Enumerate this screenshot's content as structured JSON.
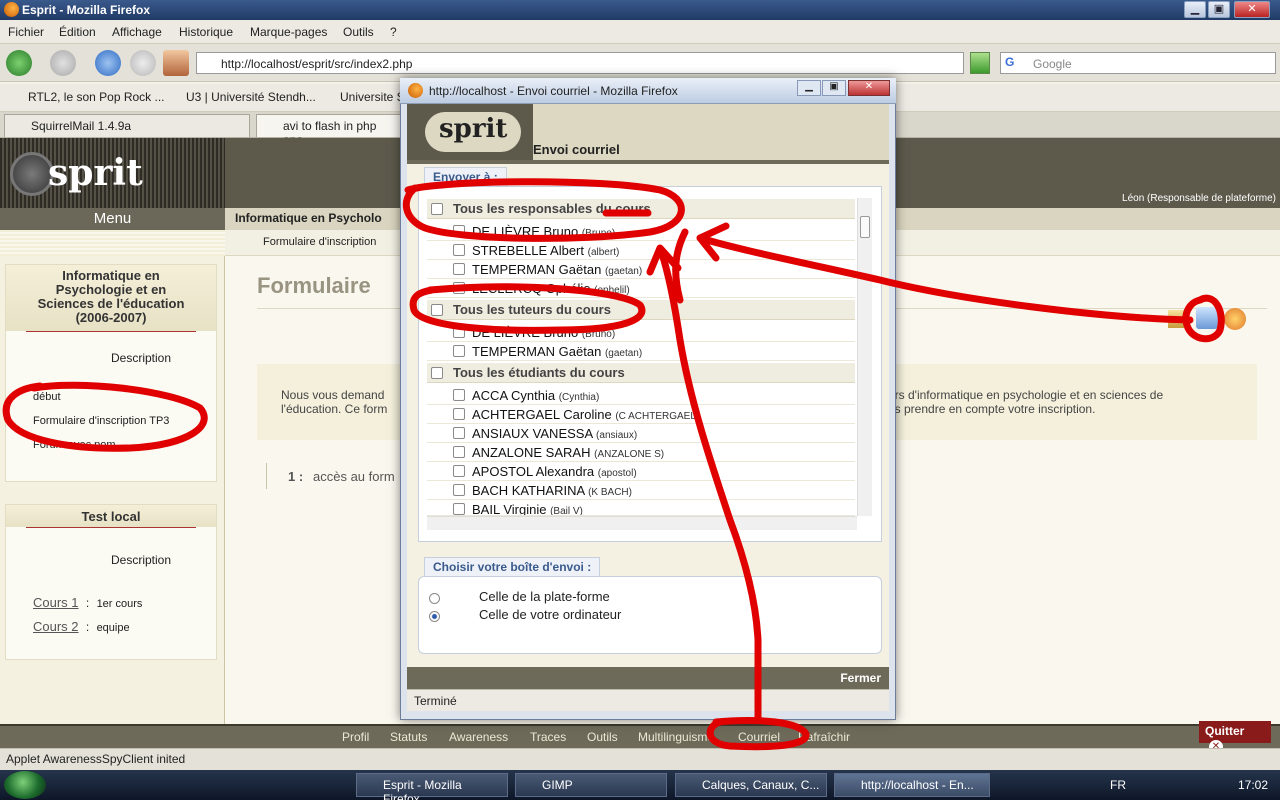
{
  "window": {
    "title": "Esprit - Mozilla Firefox",
    "min_glyph": "▁",
    "max_glyph": "▣",
    "close_glyph": "✕"
  },
  "menubar": [
    "Fichier",
    "Édition",
    "Affichage",
    "Historique",
    "Marque-pages",
    "Outils",
    "?"
  ],
  "nav": {
    "url": "http://localhost/esprit/src/index2.php",
    "search_placeholder": "Google",
    "search_engine": "G"
  },
  "bookmarks": [
    "RTL2, le son Pop Rock ...",
    "U3 | Université Stendh...",
    "Universite S"
  ],
  "tabs": [
    "SquirrelMail 1.4.9a",
    "avi to flash in php apa"
  ],
  "page": {
    "user_role": "Léon (Responsable de plateforme)",
    "menu_title": "Menu",
    "course_header": "Informatique en Psycholo",
    "breadcrumb": "Formulaire d'inscription",
    "main_title": "Formulaire",
    "intro_line1_left": "Nous vous demand",
    "intro_line1_right": "urs d'informatique en psychologie et en sciences de",
    "intro_line2_left": "l'éducation. Ce form",
    "intro_line2_right": "ns prendre en compte votre inscription.",
    "item_number": "1 :",
    "item_text": "accès au form"
  },
  "sidebar": {
    "box1": {
      "title_l1": "Informatique en",
      "title_l2": "Psychologie et en",
      "title_l3": "Sciences de l'éducation",
      "title_l4": "(2006-2007)",
      "description": "Description",
      "items": [
        "début",
        "Formulaire d'inscription TP3",
        "Forum avec pom"
      ]
    },
    "box2": {
      "title": "Test local",
      "description": "Description",
      "courses": [
        {
          "link": "Cours 1",
          "colon": ":",
          "text": "1er cours"
        },
        {
          "link": "Cours 2",
          "colon": ":",
          "text": "equipe"
        }
      ]
    }
  },
  "bottombar": [
    "Profil",
    "Statuts",
    "Awareness",
    "Traces",
    "Outils",
    "Multilinguisme",
    "Courriel",
    "Rafraîchir"
  ],
  "quit_label": "Quitter",
  "status_text": "Applet AwarenessSpyClient inited",
  "popup": {
    "title": "http://localhost - Envoi courriel - Mozilla Firefox",
    "heading": "Envoi courriel",
    "send_to_legend": "Envoyer à :",
    "groups": [
      {
        "label": "Tous les responsables du cours",
        "members": [
          {
            "name": "DE LIÈVRE Bruno",
            "login": "(Bruno)"
          },
          {
            "name": "STREBELLE Albert",
            "login": "(albert)"
          },
          {
            "name": "TEMPERMAN Gaëtan",
            "login": "(gaetan)"
          },
          {
            "name": "LECLERCQ Ophélie",
            "login": "(ophelil)"
          }
        ]
      },
      {
        "label": "Tous les tuteurs du cours",
        "members": [
          {
            "name": "DE LIÈVRE Bruno",
            "login": "(Bruno)"
          },
          {
            "name": "TEMPERMAN Gaëtan",
            "login": "(gaetan)"
          }
        ]
      },
      {
        "label": "Tous les étudiants du cours",
        "members": [
          {
            "name": "ACCA Cynthia",
            "login": "(Cynthia)"
          },
          {
            "name": "ACHTERGAEL Caroline",
            "login": "(C ACHTERGAEL)"
          },
          {
            "name": "ANSIAUX VANESSA",
            "login": "(ansiaux)"
          },
          {
            "name": "ANZALONE SARAH",
            "login": "(ANZALONE S)"
          },
          {
            "name": "APOSTOL Alexandra",
            "login": "(apostol)"
          },
          {
            "name": "BACH KATHARINA",
            "login": "(K BACH)"
          },
          {
            "name": "BAIL Virginie",
            "login": "(Bail V)"
          }
        ]
      }
    ],
    "mailbox_legend": "Choisir votre boîte d'envoi :",
    "mailbox_options": [
      "Celle de la plate-forme",
      "Celle de votre ordinateur"
    ],
    "close_label": "Fermer",
    "status": "Terminé"
  },
  "taskbar": {
    "buttons": [
      "Esprit - Mozilla Firefox",
      "GIMP",
      "Calques, Canaux, C...",
      "http://localhost - En..."
    ],
    "lang": "FR",
    "clock": "17:02"
  },
  "colors": {
    "annotation": "#e00000",
    "accent": "#3a5a8c",
    "olive": "#6d6a5a"
  }
}
